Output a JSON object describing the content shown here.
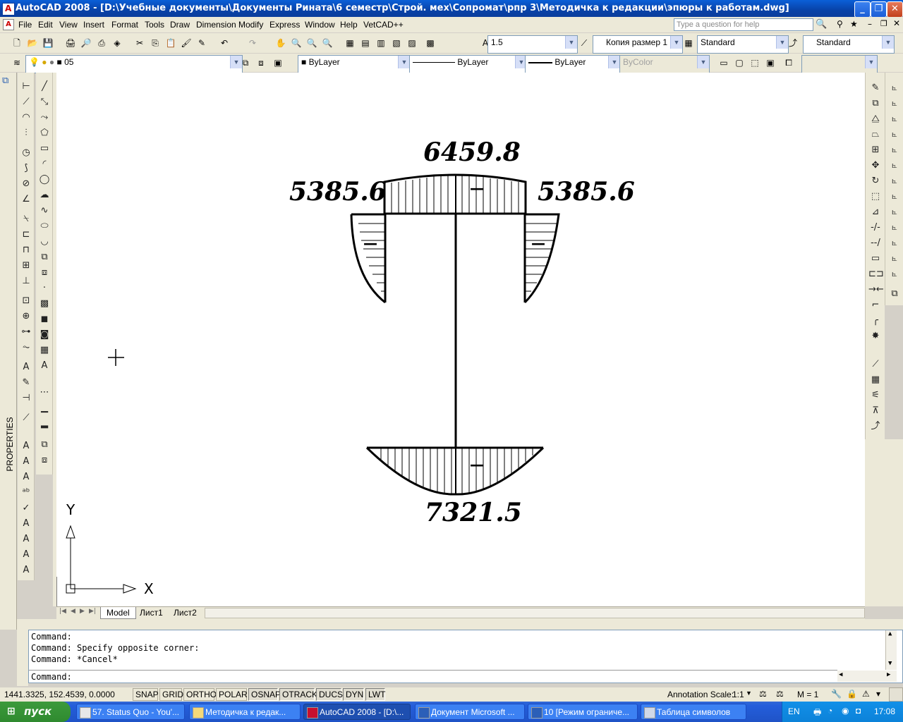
{
  "window": {
    "title": "AutoCAD 2008 - [D:\\Учебные документы\\Документы Рината\\6 семестр\\Строй. мех\\Сопромат\\рпр 3\\Методичка к редакции\\эпюры к работам.dwg]",
    "minimize": "_",
    "restore": "❐",
    "close": "✕"
  },
  "menu": {
    "items": [
      "File",
      "Edit",
      "View",
      "Insert",
      "Format",
      "Tools",
      "Draw",
      "Dimension",
      "Modify",
      "Express",
      "Window",
      "Help",
      "VetCAD++"
    ],
    "help_placeholder": "Type a question for help"
  },
  "toolbar": {
    "text_height": "1.5",
    "dim_style": "Копия размер 1",
    "text_style": "Standard",
    "table_style": "Standard"
  },
  "layers": {
    "current_layer": "05",
    "color": "ByLayer",
    "linetype": "ByLayer",
    "lineweight": "ByLayer",
    "plot_style": "ByColor"
  },
  "palette": {
    "properties_label": "PROPERTIES"
  },
  "drawing": {
    "top_label": "6459.8",
    "left_label": "5385.6",
    "right_label": "5385.6",
    "bottom_label": "7321.5",
    "sign": "—",
    "ucs_x": "X",
    "ucs_y": "Y"
  },
  "tabs": {
    "items": [
      "Model",
      "Лист1",
      "Лист2"
    ],
    "active": "Model"
  },
  "command": {
    "lines": [
      "Command:",
      "Command: Specify opposite corner:",
      "Command: *Cancel*"
    ],
    "prompt": "Command:"
  },
  "status": {
    "coords": "1441.3325, 152.4539, 0.0000",
    "buttons": [
      "SNAP",
      "GRID",
      "ORTHO",
      "POLAR",
      "OSNAP",
      "OTRACK",
      "DUCS",
      "DYN",
      "LWT"
    ],
    "active_buttons": [
      "OSNAP",
      "OTRACK",
      "DUCS",
      "DYN",
      "LWT"
    ],
    "annotation_scale_label": "Annotation Scale:",
    "annotation_scale": "1:1",
    "m_value": "M = 1"
  },
  "taskbar": {
    "start": "пуск",
    "tasks": [
      "57. Status Quo - You'...",
      "Методичка к редак...",
      "AutoCAD 2008 - [D:\\...",
      "Документ Microsoft ...",
      "10 [Режим ограниче...",
      "Таблица символов"
    ],
    "active_task": "AutoCAD 2008 - [D:\\...",
    "lang": "EN",
    "clock": "17:08"
  }
}
